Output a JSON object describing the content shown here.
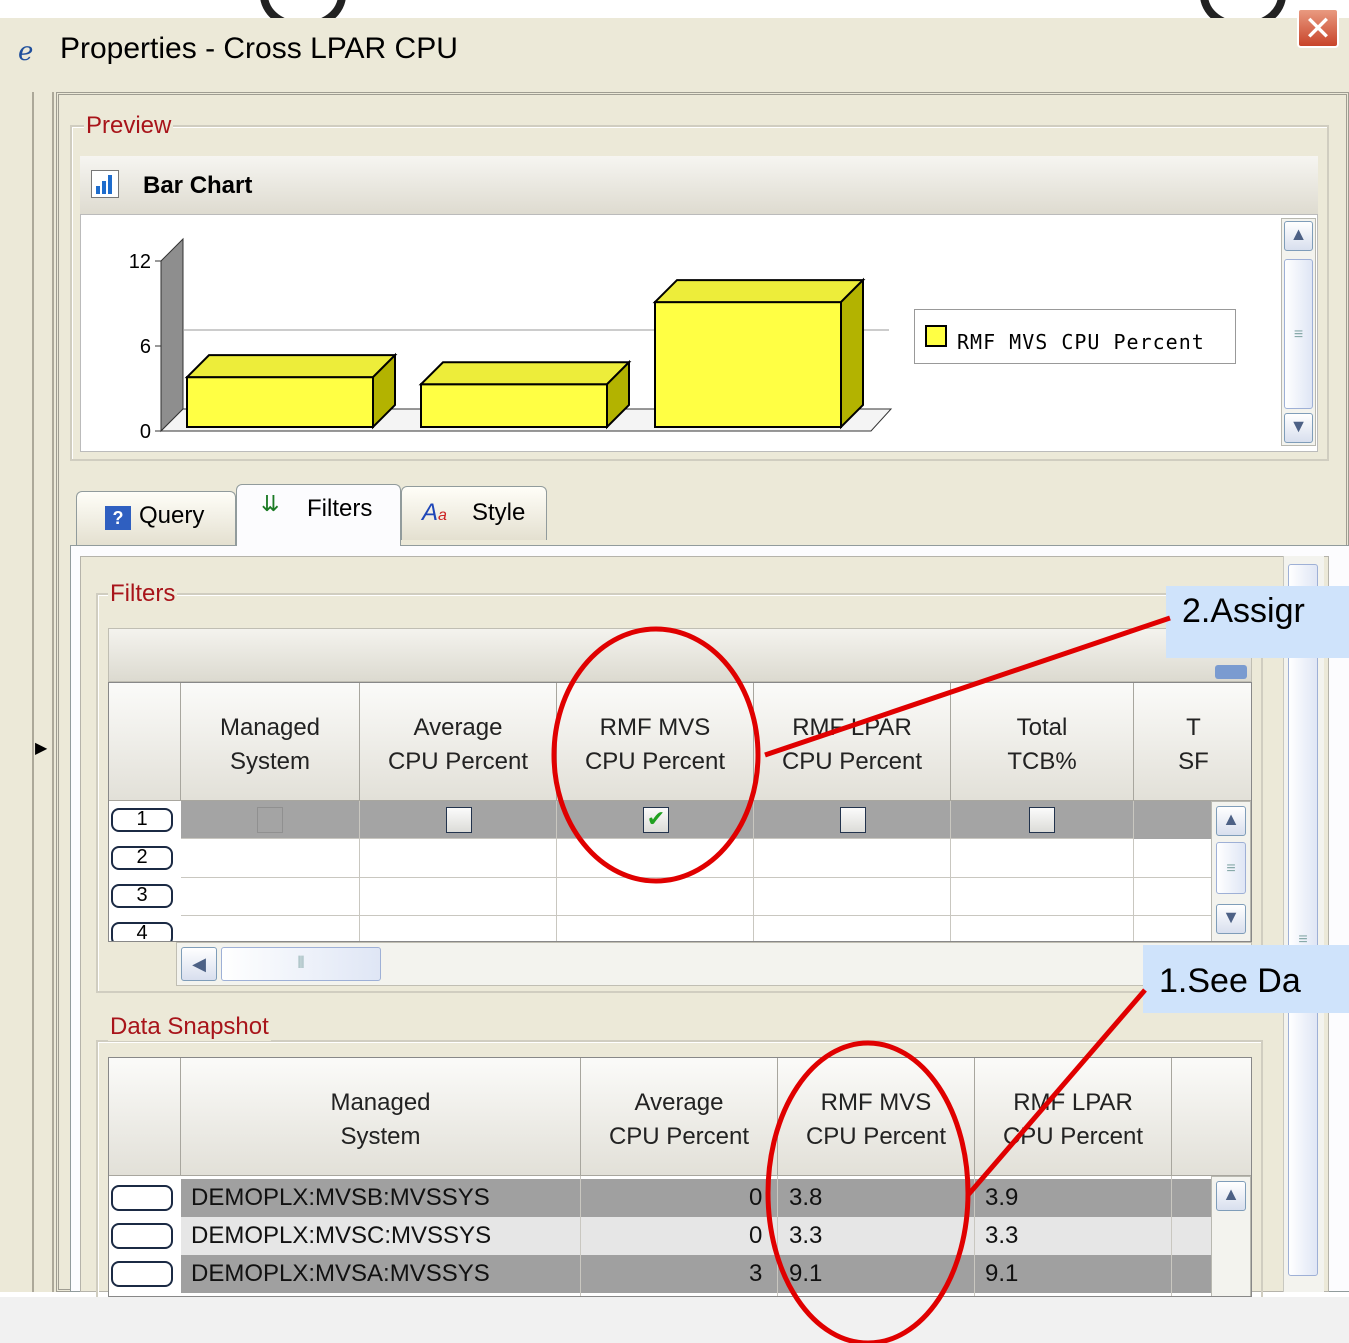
{
  "window": {
    "title": "Properties - Cross LPAR CPU",
    "close_glyph": "✕"
  },
  "preview": {
    "group_label": "Preview",
    "chart_header": "Bar Chart",
    "legend_label": "RMF MVS CPU Percent"
  },
  "chart_data": {
    "type": "bar",
    "categories": [
      "DEMOPLX:MVSB:MVSSYS",
      "DEMOPLX:MVSC:MVSSYS",
      "DEMOPLX:MVSA:MVSSYS"
    ],
    "series": [
      {
        "name": "RMF MVS CPU Percent",
        "values": [
          3.8,
          3.3,
          9.1
        ]
      }
    ],
    "yticks": [
      "12",
      "6",
      "0"
    ],
    "ylim": [
      0,
      12
    ],
    "legend": "right",
    "bar_color": "#ffff44"
  },
  "tabs": [
    {
      "label": "Query",
      "icon": "query-icon"
    },
    {
      "label": "Filters",
      "icon": "filters-icon"
    },
    {
      "label": "Style",
      "icon": "style-icon"
    }
  ],
  "filters": {
    "group_label": "Filters",
    "columns": [
      "Managed\nSystem",
      "Average\nCPU Percent",
      "RMF MVS\nCPU Percent",
      "RMF LPAR\nCPU Percent",
      "Total\nTCB%",
      "T\nSF"
    ],
    "rows": [
      "1",
      "2",
      "3",
      "4"
    ],
    "row1_checked": [
      false,
      false,
      true,
      false,
      false
    ]
  },
  "snapshot": {
    "group_label": "Data Snapshot",
    "columns": [
      "Managed\nSystem",
      "Average\nCPU Percent",
      "RMF MVS\nCPU Percent",
      "RMF LPAR\nCPU Percent"
    ],
    "rows": [
      {
        "system": "DEMOPLX:MVSB:MVSSYS",
        "avg": "0",
        "mvs": "3.8",
        "lpar": "3.9"
      },
      {
        "system": "DEMOPLX:MVSC:MVSSYS",
        "avg": "0",
        "mvs": "3.3",
        "lpar": "3.3"
      },
      {
        "system": "DEMOPLX:MVSA:MVSSYS",
        "avg": "3",
        "mvs": "9.1",
        "lpar": "9.1"
      }
    ]
  },
  "annotations": {
    "callout_1": "1.See Da",
    "callout_2": "2.Assigr",
    "color": "#e00000"
  }
}
